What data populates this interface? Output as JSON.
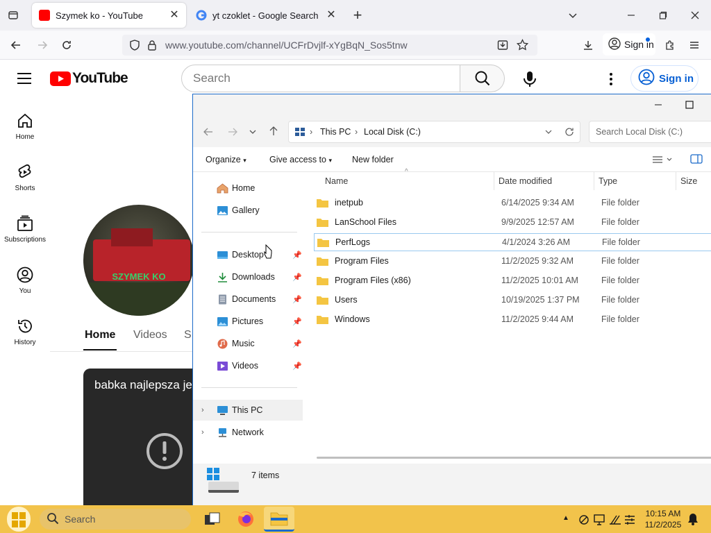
{
  "browser": {
    "tabs": [
      {
        "title": "Szymek ko - YouTube",
        "active": true
      },
      {
        "title": "yt czoklet - Google Search",
        "active": false
      }
    ],
    "url": "www.youtube.com/channel/UCFrDvjlf-xYgBqN_Sos5tnw",
    "sign_in_label": "Sign in"
  },
  "youtube": {
    "logo_text": "YouTube",
    "search_placeholder": "Search",
    "sign_in_label": "Sign in",
    "sidebar": [
      {
        "label": "Home",
        "icon": "home-icon"
      },
      {
        "label": "Shorts",
        "icon": "shorts-icon"
      },
      {
        "label": "Subscriptions",
        "icon": "subscriptions-icon"
      },
      {
        "label": "You",
        "icon": "you-icon"
      },
      {
        "label": "History",
        "icon": "history-icon"
      }
    ],
    "channel_avatar_text": "SZYMEK KO",
    "channel_tabs": [
      "Home",
      "Videos",
      "S"
    ],
    "video_title": "babka najlepsza je"
  },
  "explorer": {
    "breadcrumb": [
      "This PC",
      "Local Disk (C:)"
    ],
    "search_placeholder": "Search Local Disk (C:)",
    "commands": {
      "organize": "Organize",
      "give_access": "Give access to",
      "new_folder": "New folder"
    },
    "nav": {
      "top": [
        {
          "label": "Home",
          "icon": "home-icon"
        },
        {
          "label": "Gallery",
          "icon": "gallery-icon"
        }
      ],
      "quick_access": [
        {
          "label": "Desktop",
          "icon": "desktop-icon",
          "color": "#2c8fd6"
        },
        {
          "label": "Downloads",
          "icon": "download-icon",
          "color": "#1e8c3a"
        },
        {
          "label": "Documents",
          "icon": "documents-icon",
          "color": "#6b7a8f"
        },
        {
          "label": "Pictures",
          "icon": "pictures-icon",
          "color": "#2c8fd6"
        },
        {
          "label": "Music",
          "icon": "music-icon",
          "color": "#e06a4a"
        },
        {
          "label": "Videos",
          "icon": "videos-icon",
          "color": "#7a4bd6"
        }
      ],
      "bottom": [
        {
          "label": "This PC",
          "icon": "this-pc-icon"
        },
        {
          "label": "Network",
          "icon": "network-icon"
        }
      ]
    },
    "columns": [
      "Name",
      "Date modified",
      "Type",
      "Size"
    ],
    "files": [
      {
        "name": "inetpub",
        "date": "6/14/2025 9:34 AM",
        "type": "File folder"
      },
      {
        "name": "LanSchool Files",
        "date": "9/9/2025 12:57 AM",
        "type": "File folder"
      },
      {
        "name": "PerfLogs",
        "date": "4/1/2024 3:26 AM",
        "type": "File folder"
      },
      {
        "name": "Program Files",
        "date": "11/2/2025 9:32 AM",
        "type": "File folder"
      },
      {
        "name": "Program Files (x86)",
        "date": "11/2/2025 10:01 AM",
        "type": "File folder"
      },
      {
        "name": "Users",
        "date": "10/19/2025 1:37 PM",
        "type": "File folder"
      },
      {
        "name": "Windows",
        "date": "11/2/2025 9:44 AM",
        "type": "File folder"
      }
    ],
    "item_count": "7 items"
  },
  "taskbar": {
    "search_placeholder": "Search",
    "time": "10:15 AM",
    "date": "11/2/2025",
    "accent": "#f2c34b"
  },
  "colors": {
    "youtube_red": "#ff0000",
    "folder_yellow": "#f4c542",
    "link_blue": "#065fd4"
  }
}
